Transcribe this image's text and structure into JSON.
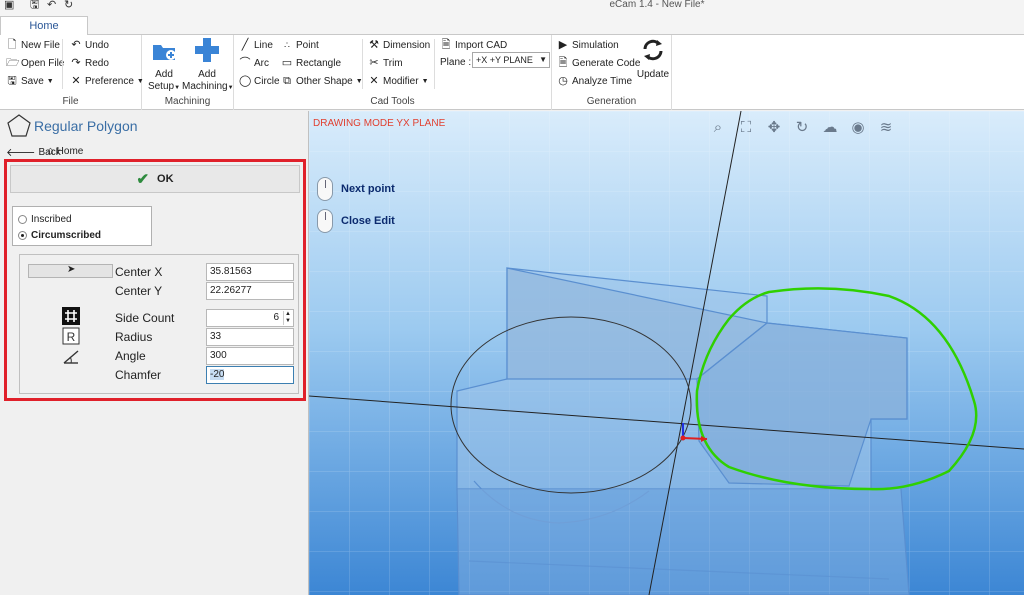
{
  "window": {
    "title": "eCam 1.4 - New File*"
  },
  "ribbon": {
    "tab_home": "Home",
    "file": {
      "new_file": "New File",
      "open_file": "Open File",
      "save": "Save",
      "undo": "Undo",
      "redo": "Redo",
      "preference": "Preference",
      "label": "File"
    },
    "machining": {
      "add_setup_1": "Add",
      "add_setup_2": "Setup",
      "add_machining_1": "Add",
      "add_machining_2": "Machining",
      "label": "Machining"
    },
    "cad_tools": {
      "line": "Line",
      "arc": "Arc",
      "circle": "Circle",
      "point": "Point",
      "rectangle": "Rectangle",
      "other_shape": "Other Shape",
      "dimension": "Dimension",
      "trim": "Trim",
      "modifier": "Modifier",
      "import_cad": "Import CAD",
      "plane_label": "Plane :",
      "plane_value": "+X +Y PLANE",
      "label": "Cad Tools"
    },
    "generation": {
      "simulation": "Simulation",
      "generate_code": "Generate Code",
      "analyze_time": "Analyze Time",
      "update": "Update",
      "label": "Generation"
    }
  },
  "panel": {
    "title": "Regular Polygon",
    "back": "Back",
    "home": "Home",
    "ok": "OK",
    "radios": [
      {
        "label": "Inscribed",
        "selected": false
      },
      {
        "label": "Circumscribed",
        "selected": true
      }
    ],
    "params": {
      "center_x_label": "Center X",
      "center_x": "35.81563",
      "center_y_label": "Center Y",
      "center_y": "22.26277",
      "side_count_label": "Side Count",
      "side_count": "6",
      "radius_label": "Radius",
      "radius": "33",
      "angle_label": "Angle",
      "angle": "300",
      "chamfer_label": "Chamfer",
      "chamfer": "-20"
    }
  },
  "viewport": {
    "mode_text": "DRAWING MODE YX PLANE",
    "hint_next": "Next point",
    "hint_close": "Close Edit",
    "tools": [
      "zoom-window-icon",
      "zoom-extents-icon",
      "pan-icon",
      "rotate-icon",
      "solid-view-icon",
      "shaded-view-icon",
      "layers-icon"
    ]
  },
  "colors": {
    "accent": "#2b5797",
    "highlight_box": "#e0202a",
    "polygon": "#2fd000",
    "viewport_top": "#d9ecfb",
    "viewport_bottom": "#3c86d4"
  }
}
